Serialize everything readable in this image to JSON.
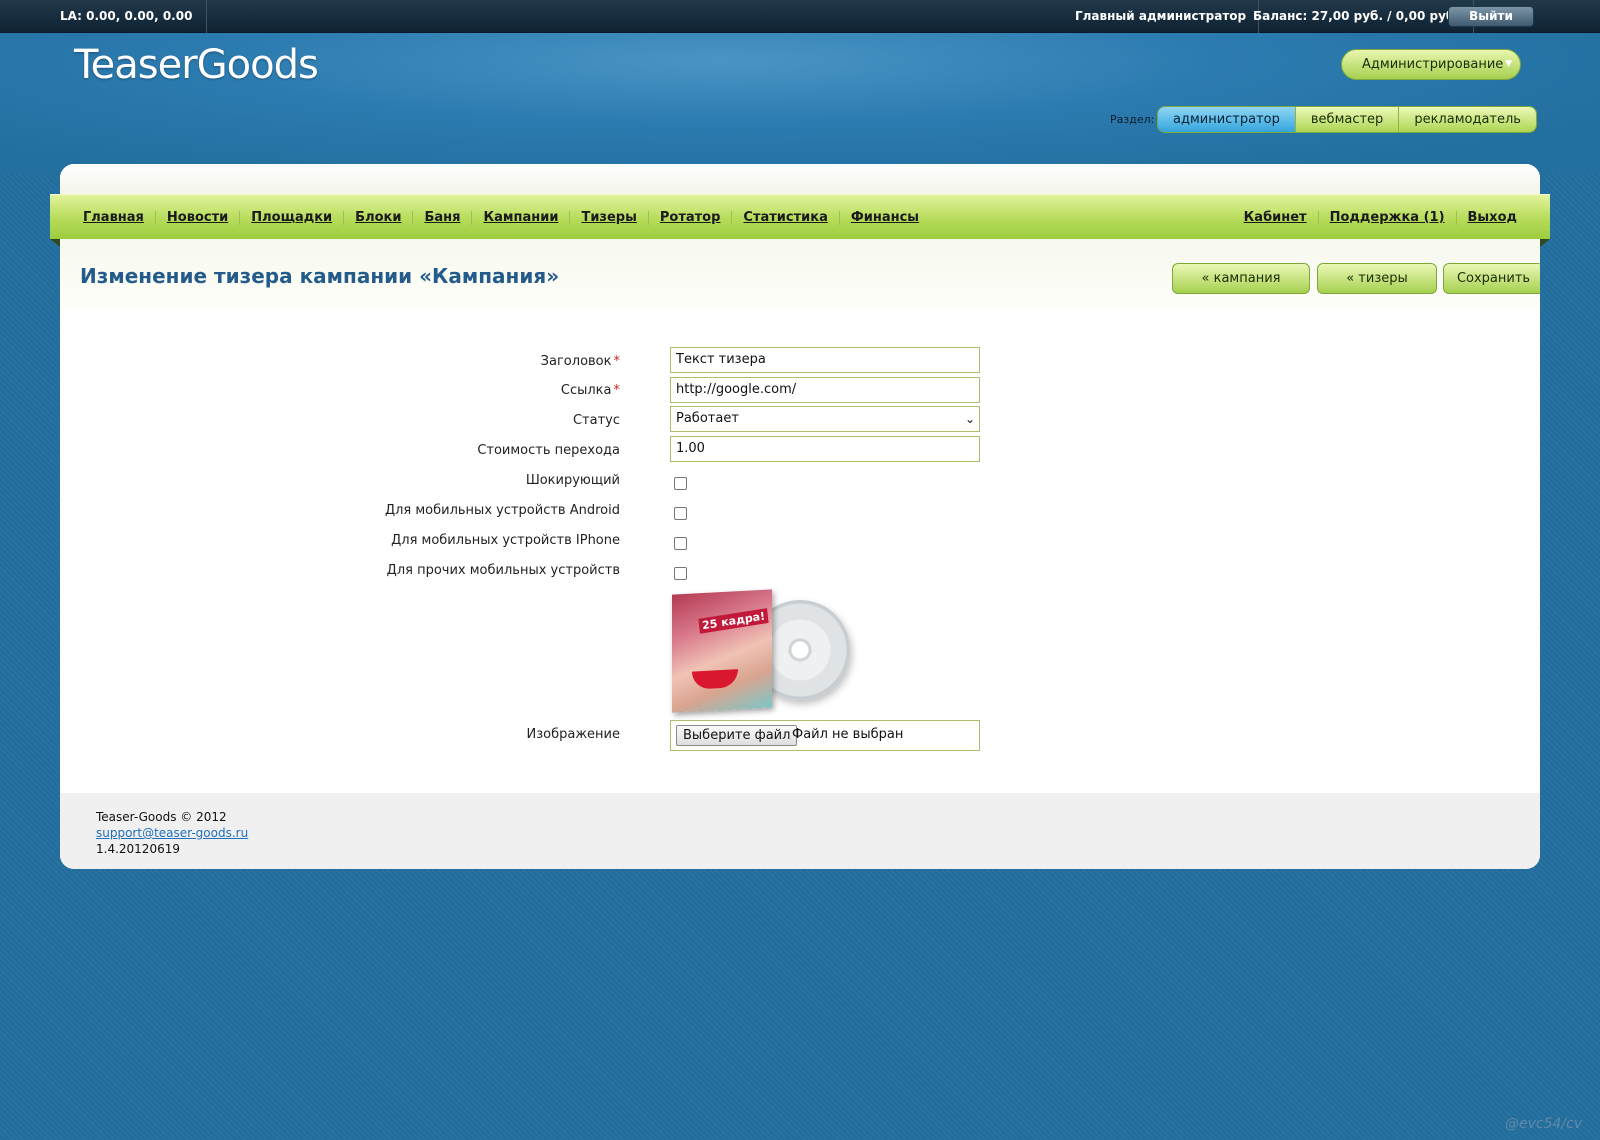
{
  "topbar": {
    "la": "LA: 0.00, 0.00, 0.00",
    "user": "Главный администратор",
    "balance": "Баланс: 27,00 руб. / 0,00 руб.",
    "logout": "Выйти"
  },
  "header": {
    "logo": "TeaserGoods",
    "admin_menu": "Администрирование",
    "section_label": "Раздел:",
    "sections": [
      "администратор",
      "вебмастер",
      "рекламодатель"
    ],
    "active_section": "администратор"
  },
  "menu": {
    "left": [
      "Главная",
      "Новости",
      "Площадки",
      "Блоки",
      "Баня",
      "Кампании",
      "Тизеры",
      "Ротатор",
      "Статистика",
      "Финансы"
    ],
    "right": [
      "Кабинет",
      "Поддержка (1)",
      "Выход"
    ]
  },
  "page": {
    "title": "Изменение тизера кампании «Кампания»",
    "btn_campaign": "« кампания",
    "btn_teasers": "« тизеры",
    "btn_save": "Сохранить"
  },
  "form": {
    "title_label": "Заголовок",
    "title_value": "Текст тизера",
    "link_label": "Ссылка",
    "link_value": "http://google.com/",
    "status_label": "Статус",
    "status_value": "Работает",
    "cost_label": "Стоимость перехода",
    "cost_value": "1.00",
    "shocking_label": "Шокирующий",
    "android_label": "Для мобильных устройств Android",
    "iphone_label": "Для мобильных устройств IPhone",
    "other_label": "Для прочих мобильных устройств",
    "image_label": "Изображение",
    "file_button": "Выберите файл",
    "file_status": "Файл не выбран",
    "image_banner": "25 кадра!",
    "required_mark": "*"
  },
  "footer": {
    "copyright": "Teaser-Goods © 2012",
    "email": "support@teaser-goods.ru",
    "version": "1.4.20120619"
  },
  "watermark": "@evc54/cv",
  "colors": {
    "accent_green": "#a6d04f",
    "active_blue": "#34a5dc",
    "title_blue": "#245b8a",
    "background": "#236f9f"
  }
}
